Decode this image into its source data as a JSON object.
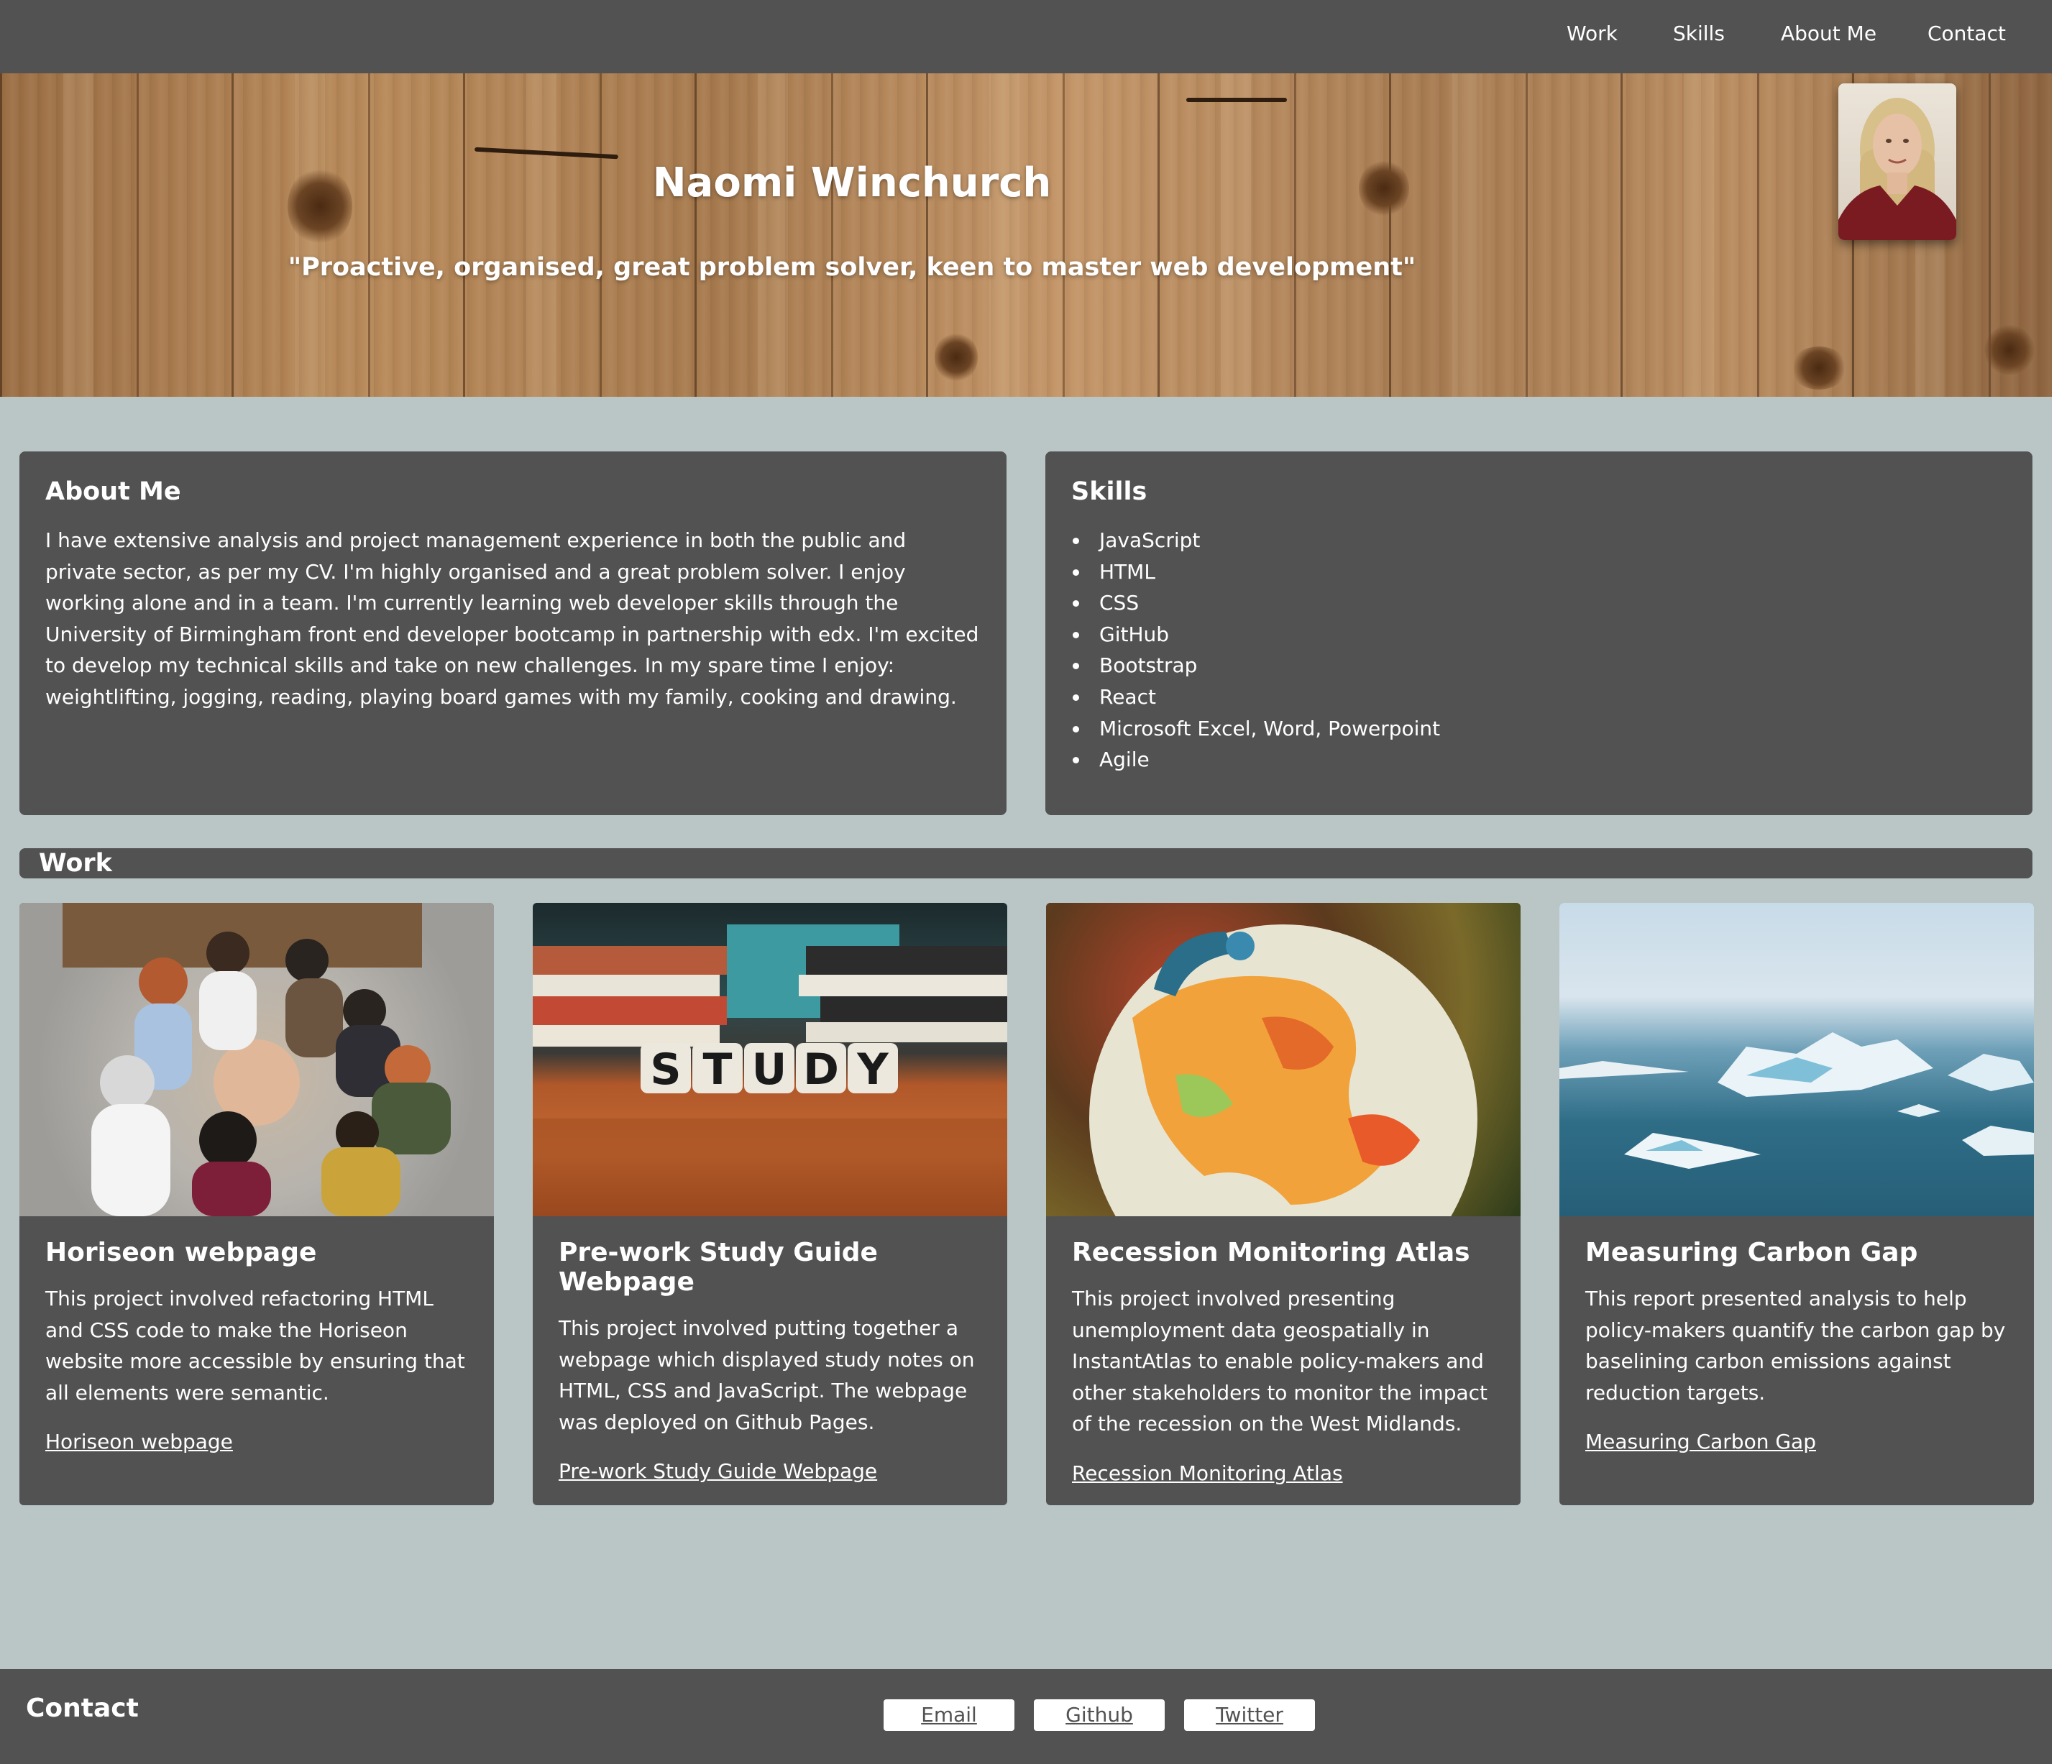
{
  "nav": {
    "items": [
      "Work",
      "Skills",
      "About Me",
      "Contact"
    ]
  },
  "hero": {
    "name": "Naomi Winchurch",
    "tagline": "\"Proactive, organised, great problem solver, keen to master web development\""
  },
  "about": {
    "heading": "About Me",
    "text": "I have extensive analysis and project management experience in both the public and private sector, as per my CV. I'm highly organised and a great problem solver. I enjoy working alone and in a team. I'm currently learning web developer skills through the University of Birmingham front end developer bootcamp in partnership with edx. I'm excited to develop my technical skills and take on new challenges. In my spare time I enjoy: weightlifting, jogging, reading, playing board games with my family, cooking and drawing."
  },
  "skills": {
    "heading": "Skills",
    "items": [
      "JavaScript",
      "HTML",
      "CSS",
      "GitHub",
      "Bootstrap",
      "React",
      "Microsoft Excel, Word, Powerpoint",
      "Agile"
    ]
  },
  "work": {
    "heading": "Work",
    "projects": [
      {
        "title": "Horiseon webpage",
        "description": "This project involved refactoring HTML and CSS code to make the Horiseon website more accessible by ensuring that all elements were semantic.",
        "link": "Horiseon webpage"
      },
      {
        "title": "Pre-work Study Guide Webpage",
        "description": "This project involved putting together a webpage which displayed study notes on HTML, CSS and JavaScript. The webpage was deployed on Github Pages.",
        "link": "Pre-work Study Guide Webpage"
      },
      {
        "title": "Recession Monitoring Atlas",
        "description": "This project involved presenting unemployment data geospatially in InstantAtlas to enable policy-makers and other stakeholders to monitor the impact of the recession on the West Midlands.",
        "link": "Recession Monitoring Atlas"
      },
      {
        "title": "Measuring Carbon Gap",
        "description": "This report presented analysis to help policy-makers quantify the carbon gap by baselining carbon emissions against reduction targets.",
        "link": "Measuring Carbon Gap"
      }
    ],
    "study_tile_letters": [
      "S",
      "T",
      "U",
      "D",
      "Y"
    ]
  },
  "footer": {
    "heading": "Contact",
    "buttons": [
      "Email",
      "Github",
      "Twitter"
    ]
  }
}
